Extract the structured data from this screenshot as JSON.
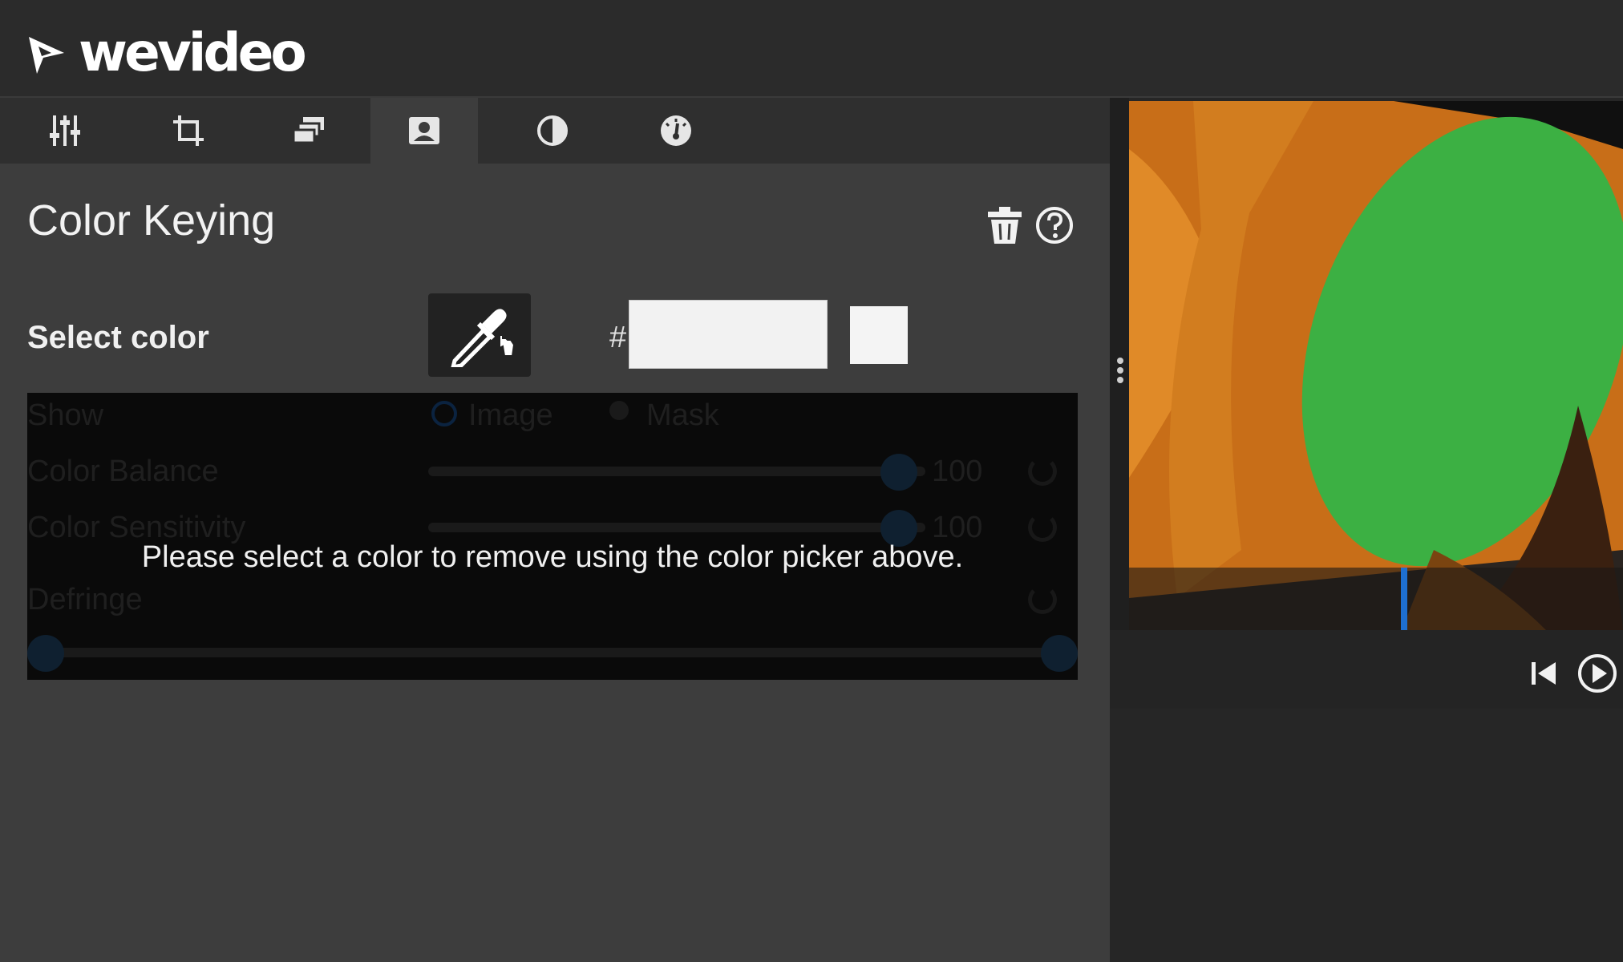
{
  "app": {
    "logo_text": "wevideo"
  },
  "tabs": [
    {
      "name": "adjust",
      "icon": "sliders-icon",
      "active": false
    },
    {
      "name": "crop",
      "icon": "crop-icon",
      "active": false
    },
    {
      "name": "layers",
      "icon": "layers-icon",
      "active": false
    },
    {
      "name": "color-keying",
      "icon": "portrait-icon",
      "active": true
    },
    {
      "name": "contrast",
      "icon": "contrast-icon",
      "active": false
    },
    {
      "name": "speed",
      "icon": "speedometer-icon",
      "active": false
    }
  ],
  "panel": {
    "title": "Color Keying",
    "select_label": "Select color",
    "hash": "#",
    "hex_value": "",
    "swatch_color": "#f4f4f4",
    "overlay_message": "Please select a color to remove using the color picker above.",
    "disabled": {
      "show_label": "Show",
      "option_image": "Image",
      "option_mask": "Mask",
      "color_balance_label": "Color Balance",
      "color_balance_value": "100",
      "color_sensitivity_label": "Color Sensitivity",
      "color_sensitivity_value": "100",
      "defringe_label": "Defringe"
    }
  },
  "colors": {
    "accent": "#1e6fd0",
    "key_green": "#3cb043",
    "tent_orange": "#d9781c"
  }
}
